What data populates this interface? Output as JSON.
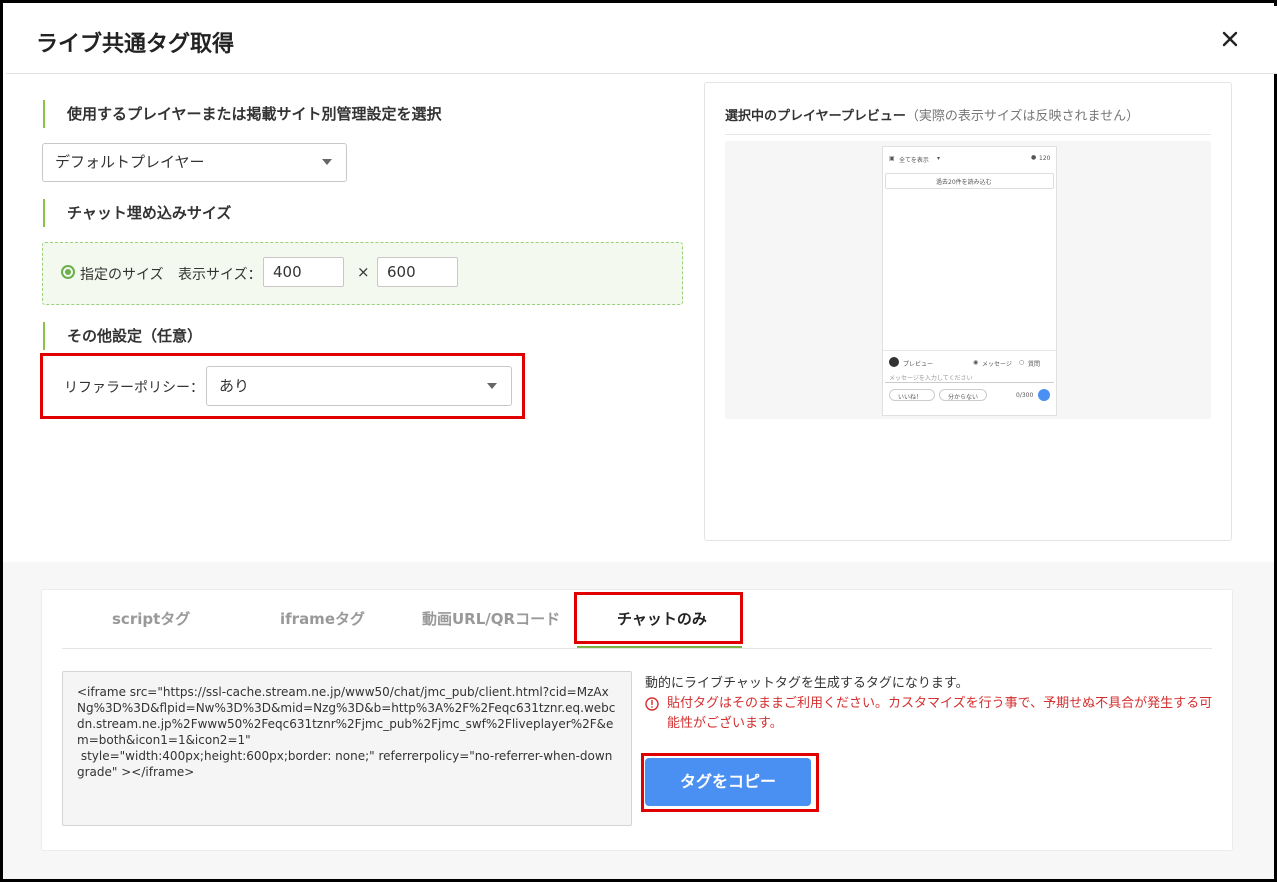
{
  "dialog": {
    "title": "ライブ共通タグ取得"
  },
  "player_section": {
    "label": "使用するプレイヤーまたは掲載サイト別管理設定を選択",
    "selected": "デフォルトプレイヤー"
  },
  "size_section": {
    "label": "チャット埋め込みサイズ",
    "radio_label": "指定のサイズ",
    "display_size_label": "表示サイズ：",
    "width": "400",
    "times": "×",
    "height": "600"
  },
  "other_section": {
    "label": "その他設定（任意）",
    "referrer_label": "リファラーポリシー：",
    "referrer_value": "あり"
  },
  "preview": {
    "title": "選択中のプレイヤープレビュー",
    "note": "（実際の表示サイズは反映されません）",
    "chat": {
      "filter": "全てを表示",
      "viewers": "120",
      "load_more": "過去20件を読み込む",
      "user": "プレビュー",
      "mode_message": "メッセージ",
      "mode_other": "質問",
      "input_placeholder": "メッセージを入力してください",
      "like": "いいね！",
      "unclear": "分からない",
      "counter": "0/300"
    }
  },
  "tabs": [
    {
      "label": "scriptタグ"
    },
    {
      "label": "iframeタグ"
    },
    {
      "label": "動画URL/QRコード"
    },
    {
      "label": "チャットのみ"
    }
  ],
  "output": {
    "code": "<iframe src=\"https://ssl-cache.stream.ne.jp/www50/chat/jmc_pub/client.html?cid=MzAxNg%3D%3D&flpid=Nw%3D%3D&mid=Nzg%3D&b=http%3A%2F%2Feqc631tznr.eq.webcdn.stream.ne.jp%2Fwww50%2Feqc631tznr%2Fjmc_pub%2Fjmc_swf%2Fliveplayer%2F&em=both&icon1=1&icon2=1\"\n style=\"width:400px;height:600px;border: none;\" referrerpolicy=\"no-referrer-when-downgrade\" ></iframe>",
    "description": "動的にライブチャットタグを生成するタグになります。",
    "warning": "貼付タグはそのままご利用ください。カスタマイズを行う事で、予期せぬ不具合が発生する可能性がございます。",
    "copy_button": "タグをコピー"
  },
  "colors": {
    "accent_green": "#7cb342",
    "button_blue": "#4a8ff2",
    "highlight_red": "#e00000",
    "warning_red": "#d32f2f"
  }
}
